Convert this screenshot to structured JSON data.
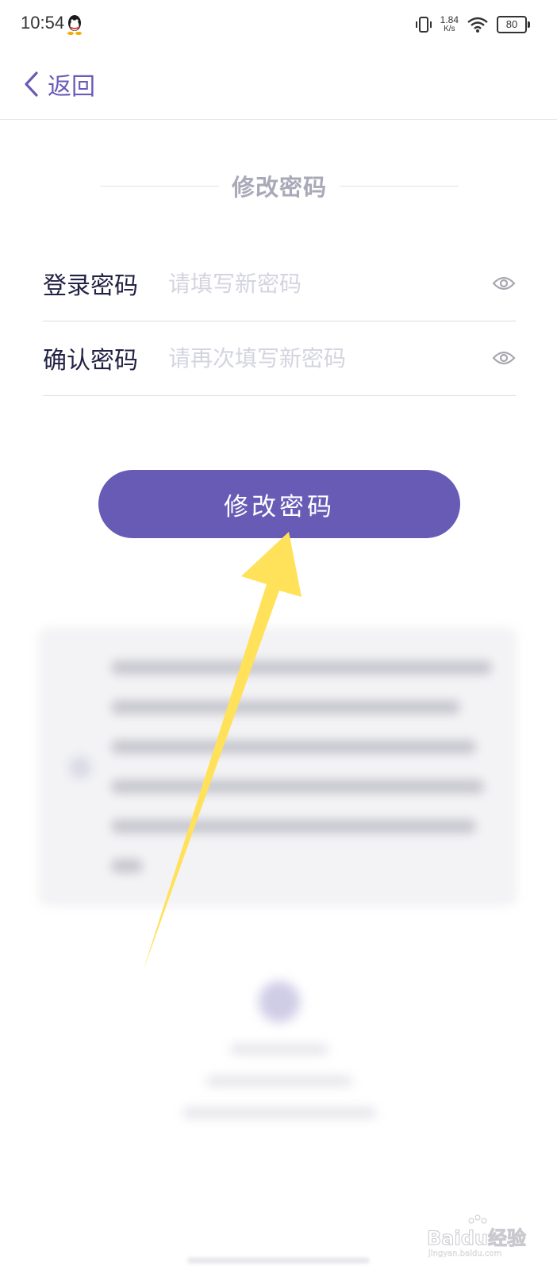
{
  "status_bar": {
    "time": "10:54",
    "net_speed_value": "1.84",
    "net_speed_unit": "K/s",
    "battery": "80"
  },
  "nav": {
    "back_label": "返回"
  },
  "page": {
    "section_title": "修改密码"
  },
  "form": {
    "password_label": "登录密码",
    "password_placeholder": "请填写新密码",
    "confirm_label": "确认密码",
    "confirm_placeholder": "请再次填写新密码"
  },
  "submit_label": "修改密码",
  "colors": {
    "accent": "#675bb6",
    "arrow": "#ffe15a"
  },
  "watermark": {
    "text": "Baidu经验",
    "subtext": "jingyan.baidu.com"
  }
}
